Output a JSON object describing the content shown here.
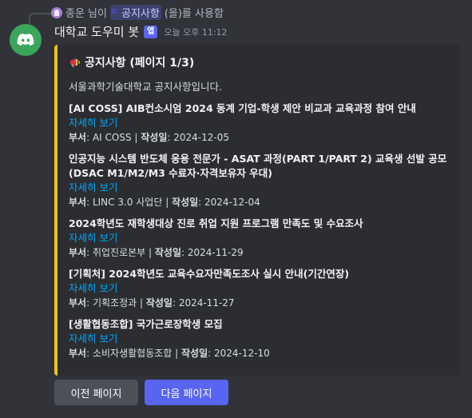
{
  "command_line": {
    "user": "종운 님이",
    "command": "공지사항",
    "suffix": "(을)를 사용함"
  },
  "message": {
    "bot_name": "대학교 도우미 봇",
    "app_tag": "앱",
    "timestamp": "오늘 오후 11:12"
  },
  "embed": {
    "accent_color": "#f0c419",
    "title_icon": "megaphone-icon",
    "title": "공지사항 (페이지 1/3)",
    "description": "서울과학기술대학교 공지사항입니다.",
    "notices": [
      {
        "title": "[AI COSS] AIB컨소시엄 2024 동계 기업-학생 제안 비교과 교육과정 참여 안내",
        "link": "자세히 보기",
        "dept_label": "부서",
        "dept": "AI COSS",
        "date_label": "작성일",
        "date": "2024-12-05"
      },
      {
        "title": "인공지능 시스템 반도체 응용 전문가 - ASAT 과정(PART 1/PART 2) 교육생 선발 공모(DSAC M1/M2/M3 수료자·자격보유자 우대)",
        "link": "자세히 보기",
        "dept_label": "부서",
        "dept": "LINC 3.0 사업단",
        "date_label": "작성일",
        "date": "2024-12-04"
      },
      {
        "title": "2024학년도 재학생대상 진로 취업 지원 프로그램 만족도 및 수요조사",
        "link": "자세히 보기",
        "dept_label": "부서",
        "dept": "취업진로본부",
        "date_label": "작성일",
        "date": "2024-11-29"
      },
      {
        "title": "[기획처] 2024학년도 교육수요자만족도조사 실시 안내(기간연장)",
        "link": "자세히 보기",
        "dept_label": "부서",
        "dept": "기획조정과",
        "date_label": "작성일",
        "date": "2024-11-27"
      },
      {
        "title": "[생활협동조합] 국가근로장학생 모집",
        "link": "자세히 보기",
        "dept_label": "부서",
        "dept": "소비자생활협동조합",
        "date_label": "작성일",
        "date": "2024-12-10"
      }
    ]
  },
  "buttons": {
    "prev": "이전 페이지",
    "next": "다음 페이지"
  },
  "colors": {
    "background": "#313338",
    "embed_bg": "#2b2d31",
    "link": "#00a8fc",
    "primary_button": "#5865f2",
    "secondary_button": "#4e5058",
    "bot_avatar": "#3ba55c"
  }
}
